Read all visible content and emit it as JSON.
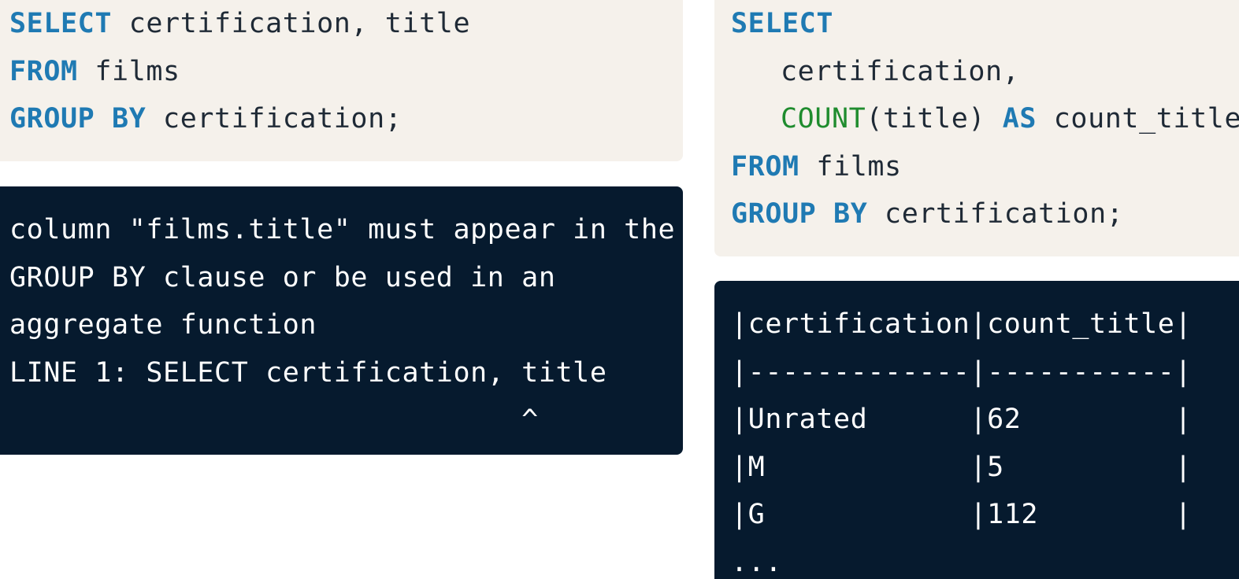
{
  "left_query": {
    "line1": {
      "kw": "SELECT",
      "rest": " certification, title"
    },
    "line2": {
      "kw": "FROM",
      "rest": " films"
    },
    "line3": {
      "kw": "GROUP BY",
      "rest": " certification;"
    }
  },
  "error_output": {
    "lines": [
      "column \"films.title\" must appear in the",
      "GROUP BY clause or be used in an",
      "aggregate function",
      "LINE 1: SELECT certification, title",
      "                              ^"
    ]
  },
  "right_query": {
    "line1": {
      "kw": "SELECT"
    },
    "line2": {
      "text": "certification,"
    },
    "line3": {
      "fn": "COUNT",
      "args": "(title) ",
      "kw": "AS",
      "alias": " count_title"
    },
    "line4": {
      "kw": "FROM",
      "rest": " films"
    },
    "line5": {
      "kw": "GROUP BY",
      "rest": " certification;"
    }
  },
  "result_output": {
    "lines": [
      "|certification|count_title|",
      "|-------------|-----------|",
      "|Unrated      |62         |",
      "|M            |5          |",
      "|G            |112        |",
      "..."
    ]
  },
  "colors": {
    "code_bg": "#f5f1eb",
    "terminal_bg": "#061a2e",
    "keyword": "#1f7ab3",
    "function": "#1f8c2e"
  }
}
